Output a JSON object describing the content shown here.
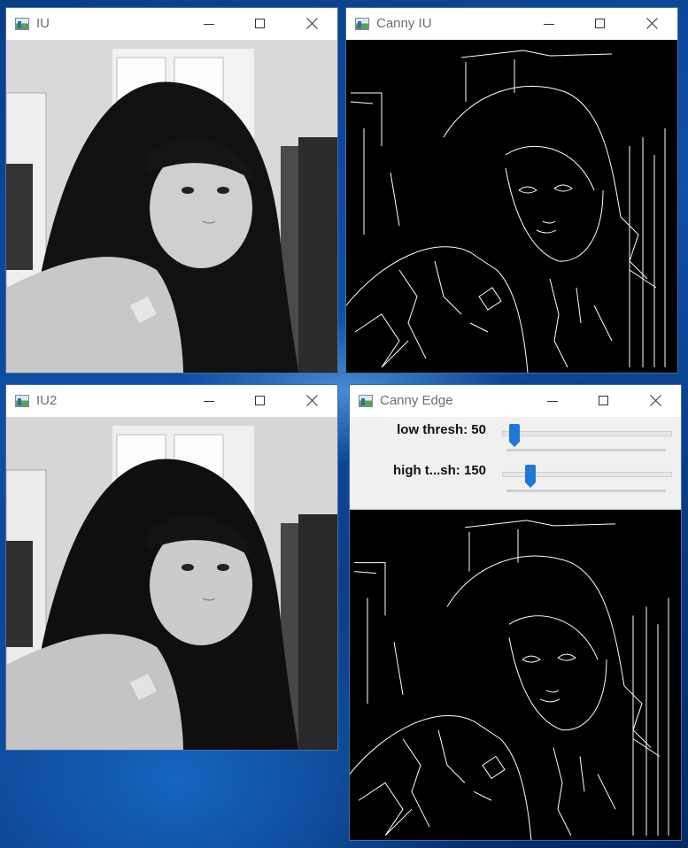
{
  "windows": {
    "iu": {
      "title": "IU"
    },
    "canny_iu": {
      "title": "Canny IU"
    },
    "iu2": {
      "title": "IU2"
    },
    "canny_edge": {
      "title": "Canny Edge",
      "trackbars": [
        {
          "label": "low thresh: 50",
          "value": 50
        },
        {
          "label": "high t...sh: 150",
          "value": 150
        }
      ]
    }
  },
  "colors": {
    "titlebar": "#ffffff",
    "trackbar_thumb": "#1e78d6",
    "canny_background": "#000000"
  }
}
